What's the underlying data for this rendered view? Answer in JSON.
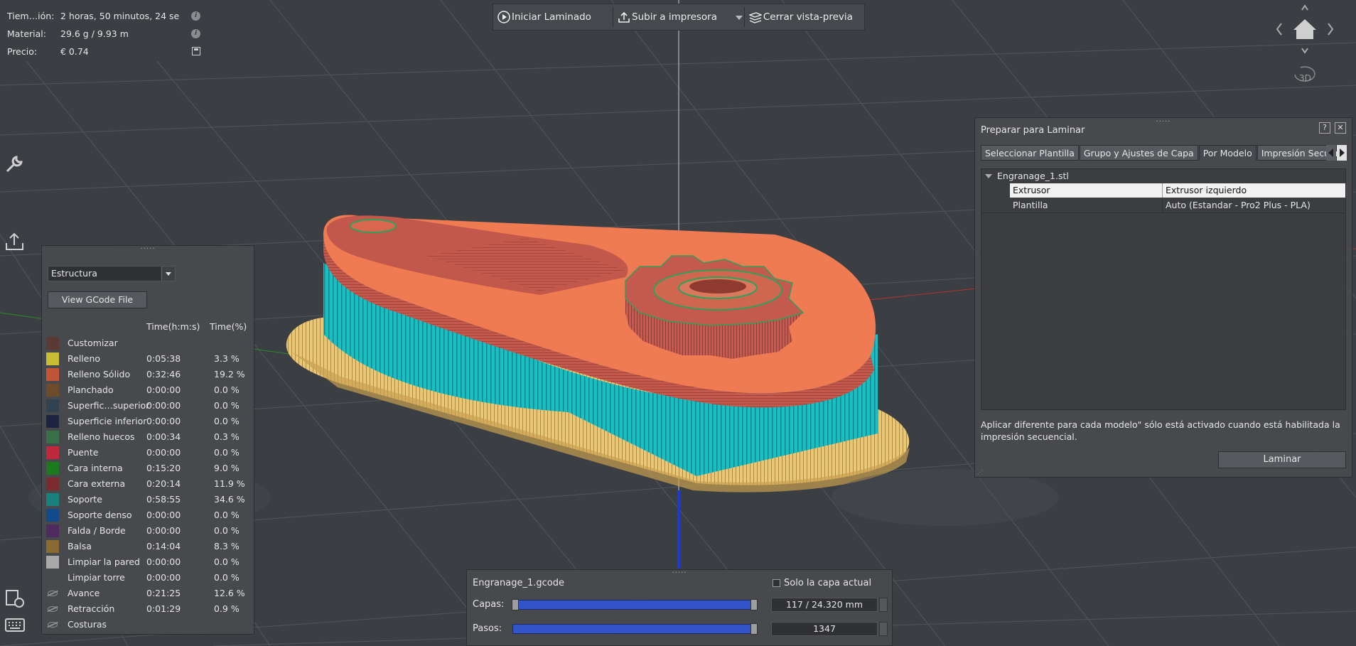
{
  "stats": {
    "time_label": "Tiem…ión:",
    "time_value": "2 horas, 50 minutos, 24 se",
    "material_label": "Material:",
    "material_value": "29.6 g / 9.93 m",
    "price_label": "Precio:",
    "price_value": "€ 0.74"
  },
  "toolbar": {
    "start_slicing": "Iniciar Laminado",
    "upload_printer": "Subir a impresora",
    "close_preview": "Cerrar vista-previa"
  },
  "nav": {
    "view_3d": "3D"
  },
  "legend": {
    "handle": "·····",
    "view_mode": "Estructura",
    "view_gcode_button": "View GCode File",
    "col_time": "Time(h:m:s)",
    "col_pct": "Time(%)",
    "rows": [
      {
        "name": "Customizar",
        "time": "",
        "pct": "",
        "color": "#5a3a32"
      },
      {
        "name": "Relleno",
        "time": "0:05:38",
        "pct": "3.3 %",
        "color": "#c8be33"
      },
      {
        "name": "Relleno Sólido",
        "time": "0:32:46",
        "pct": "19.2 %",
        "color": "#c25536"
      },
      {
        "name": "Planchado",
        "time": "0:00:00",
        "pct": "0.0 %",
        "color": "#6e4c2a"
      },
      {
        "name": "Superfic…superior",
        "time": "0:00:00",
        "pct": "0.0 %",
        "color": "#334250"
      },
      {
        "name": "Superficie inferior",
        "time": "0:00:00",
        "pct": "0.0 %",
        "color": "#1d2340"
      },
      {
        "name": "Relleno huecos",
        "time": "0:00:34",
        "pct": "0.3 %",
        "color": "#3a7048"
      },
      {
        "name": "Puente",
        "time": "0:00:00",
        "pct": "0.0 %",
        "color": "#c0283b"
      },
      {
        "name": "Cara interna",
        "time": "0:15:20",
        "pct": "9.0 %",
        "color": "#1c7a1e"
      },
      {
        "name": "Cara externa",
        "time": "0:20:14",
        "pct": "11.9 %",
        "color": "#7c2c2c"
      },
      {
        "name": "Soporte",
        "time": "0:58:55",
        "pct": "34.6 %",
        "color": "#1a807d"
      },
      {
        "name": "Soporte denso",
        "time": "0:00:00",
        "pct": "0.0 %",
        "color": "#134a8a"
      },
      {
        "name": "Falda / Borde",
        "time": "0:00:00",
        "pct": "0.0 %",
        "color": "#4e2a5e"
      },
      {
        "name": "Balsa",
        "time": "0:14:04",
        "pct": "8.3 %",
        "color": "#8a6a30"
      },
      {
        "name": "Limpiar la pared",
        "time": "0:00:00",
        "pct": "0.0 %",
        "color": "#a9a9a9"
      },
      {
        "name": "Limpiar torre",
        "time": "0:00:00",
        "pct": "0.0 %",
        "color": ""
      },
      {
        "name": "Avance",
        "time": "0:21:25",
        "pct": "12.6 %",
        "color": "eye"
      },
      {
        "name": "Retracción",
        "time": "0:01:29",
        "pct": "0.9 %",
        "color": "eye"
      },
      {
        "name": "Costuras",
        "time": "",
        "pct": "",
        "color": "eye"
      }
    ]
  },
  "prepare": {
    "handle": "·····",
    "title": "Preparar para Laminar",
    "help": "?",
    "close": "✕",
    "tabs": [
      "Seleccionar Plantilla",
      "Grupo y Ajustes de Capa",
      "Por Modelo",
      "Impresión Secuencial"
    ],
    "active_tab": 2,
    "tree": {
      "file": "Engranage_1.stl",
      "rows": [
        {
          "key": "Extrusor",
          "value": "Extrusor izquierdo"
        },
        {
          "key": "Plantilla",
          "value": "Auto (Estandar - Pro2 Plus - PLA)"
        }
      ]
    },
    "note": "Aplicar diferente para cada modelo\" sólo está activado cuando está habilitada la impresión secuencial.",
    "slice_button": "Laminar"
  },
  "layers": {
    "handle": "·····",
    "filename": "Engranage_1.gcode",
    "only_current_layer": "Solo la capa actual",
    "layers_label": "Capas:",
    "layers_value": "117 / 24.320 mm",
    "steps_label": "Pasos:",
    "steps_value": "1347",
    "layers_progress": 1.0,
    "steps_progress": 1.0
  },
  "colors": {
    "infill_orange": "#f07a52",
    "wall_red": "#c45a4e",
    "support_cyan": "#19c3c7",
    "raft_yellow": "#e5c46d",
    "slider_blue": "#3154c9"
  }
}
